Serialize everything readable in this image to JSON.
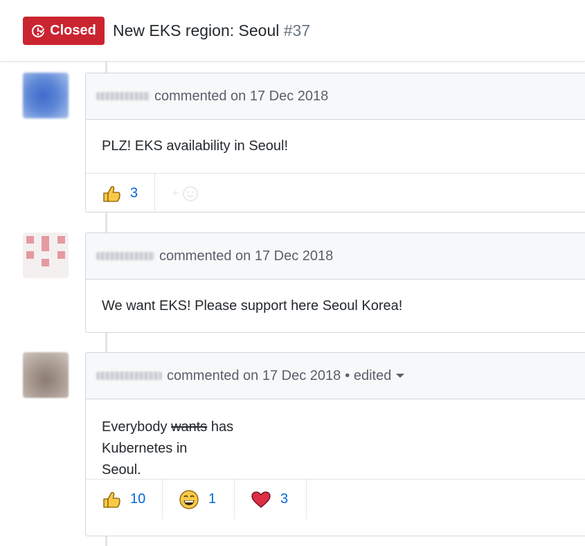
{
  "issue": {
    "state_label": "Closed",
    "title": "New EKS region: Seoul",
    "number": "#37",
    "state_color": "#cb2431"
  },
  "comments": [
    {
      "meta": "commented on 17 Dec 2018",
      "body": "PLZ! EKS availability in Seoul!",
      "reactions": [
        {
          "icon": "thumbs-up-icon",
          "count": "3"
        }
      ]
    },
    {
      "meta": "commented on 17 Dec 2018",
      "body": "We want EKS! Please support here Seoul Korea!"
    },
    {
      "meta": "commented on 17 Dec 2018",
      "edited": "• edited",
      "body_lines": [
        {
          "first": "Everybody ",
          "struck": "wants",
          "rest": " has"
        },
        "Kubernetes in",
        "Seoul."
      ],
      "reactions": [
        {
          "icon": "thumbs-up-icon",
          "count": "10"
        },
        {
          "icon": "laugh-icon",
          "count": "1"
        },
        {
          "icon": "heart-icon",
          "count": "3"
        }
      ]
    }
  ],
  "colors": {
    "link": "#0366d6",
    "muted": "#586069",
    "border": "#d1d5da",
    "header_bg": "#f6f8fa"
  }
}
